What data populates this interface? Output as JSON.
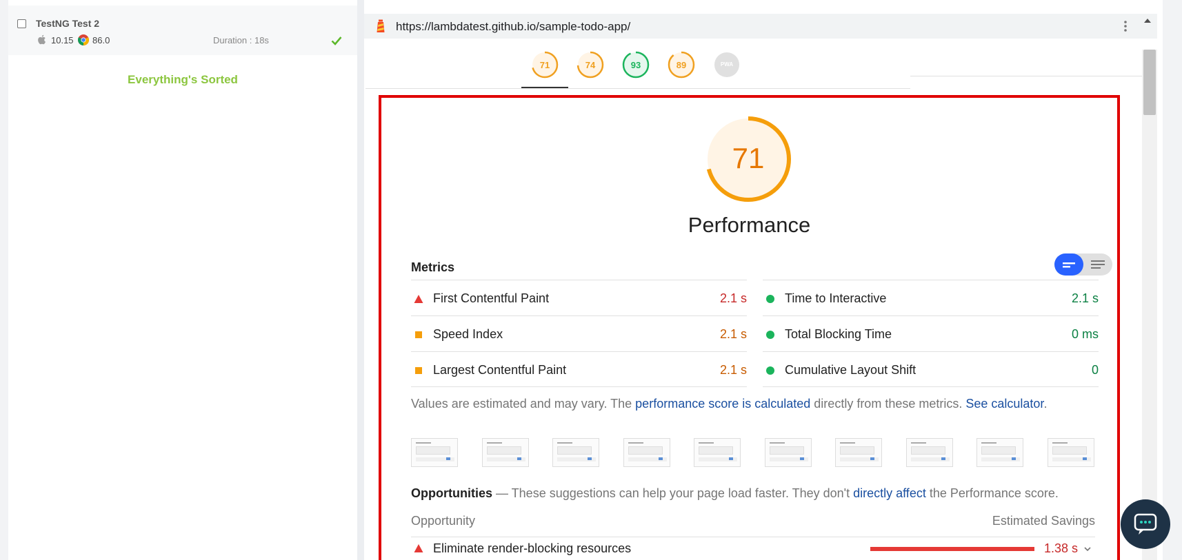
{
  "left_panel": {
    "test": {
      "name": "TestNG Test 2",
      "os_version": "10.15",
      "browser_version": "86.0",
      "duration": "Duration : 18s"
    },
    "status_message": "Everything's Sorted"
  },
  "browser": {
    "url": "https://lambdatest.github.io/sample-todo-app/"
  },
  "lighthouse": {
    "category_gauges": [
      {
        "score": "71",
        "color": "#f0a020"
      },
      {
        "score": "74",
        "color": "#f0a020"
      },
      {
        "score": "93",
        "color": "#1bb45c"
      },
      {
        "score": "89",
        "color": "#f0a020"
      },
      {
        "score": "PWA",
        "color": "#9e9e9e"
      }
    ],
    "performance": {
      "score": "71",
      "score_fraction": 0.71,
      "title": "Performance"
    },
    "metrics_heading": "Metrics",
    "metrics_left": [
      {
        "label": "First Contentful Paint",
        "value": "2.1 s",
        "status": "fail"
      },
      {
        "label": "Speed Index",
        "value": "2.1 s",
        "status": "average"
      },
      {
        "label": "Largest Contentful Paint",
        "value": "2.1 s",
        "status": "average"
      }
    ],
    "metrics_right": [
      {
        "label": "Time to Interactive",
        "value": "2.1 s",
        "status": "pass"
      },
      {
        "label": "Total Blocking Time",
        "value": "0 ms",
        "status": "pass"
      },
      {
        "label": "Cumulative Layout Shift",
        "value": "0",
        "status": "pass"
      }
    ],
    "note": {
      "prefix": "Values are estimated and may vary. The ",
      "link1": "performance score is calculated",
      "middle": " directly from these metrics. ",
      "link2": "See calculator",
      "suffix": "."
    },
    "opportunities": {
      "title": "Opportunities",
      "desc_prefix": " — These suggestions can help your page load faster. They don't ",
      "desc_link": "directly affect",
      "desc_suffix": " the Performance score.",
      "col_opportunity": "Opportunity",
      "col_savings": "Estimated Savings",
      "items": [
        {
          "label": "Eliminate render-blocking resources",
          "savings": "1.38 s"
        }
      ]
    }
  },
  "colors": {
    "fail": "#e53935",
    "average": "#f59e0b",
    "pass": "#1bb45c",
    "fail_text": "#c62828",
    "average_text": "#c75b00",
    "pass_text": "#0b8043",
    "accent": "#2962ff"
  }
}
